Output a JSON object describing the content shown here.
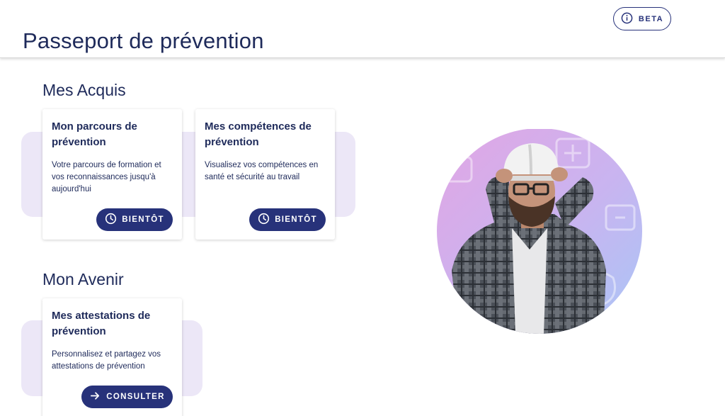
{
  "header": {
    "title": "Passeport de prévention",
    "beta_label": "BETA",
    "beta_icon": "info-icon"
  },
  "sections": {
    "acquis": {
      "title": "Mes Acquis",
      "cards": [
        {
          "title_line1": "Mon parcours de",
          "title_line2": "prévention",
          "desc_line1": "Votre parcours de formation et",
          "desc_line2": "vos reconnaissances jusqu'à",
          "desc_line3": "aujourd'hui",
          "button_label": "BIENTÔT",
          "button_icon": "clock-icon"
        },
        {
          "title_line1": "Mes compétences de",
          "title_line2": "prévention",
          "desc_line1": "Visualisez vos compétences en",
          "desc_line2": "santé et sécurité au travail",
          "button_label": "BIENTÔT",
          "button_icon": "clock-icon"
        }
      ]
    },
    "avenir": {
      "title": "Mon Avenir",
      "cards": [
        {
          "title_line1": "Mes attestations de",
          "title_line2": "prévention",
          "desc_line1": "Personnalisez et partagez vos",
          "desc_line2": "attestations de prévention",
          "button_label": "CONSULTER",
          "button_icon": "arrow-right-icon"
        }
      ]
    }
  },
  "colors": {
    "primary": "#27327a",
    "text": "#1e2a5a",
    "blob": "#ece7f7"
  }
}
